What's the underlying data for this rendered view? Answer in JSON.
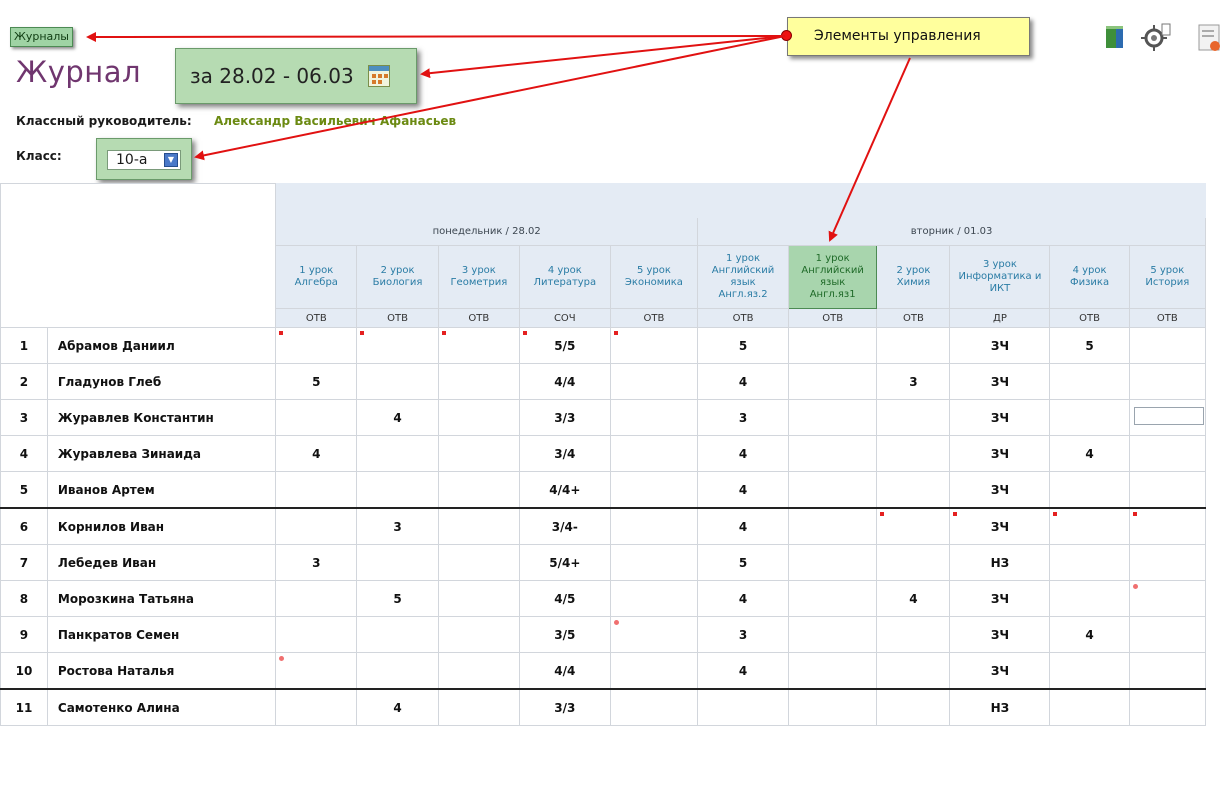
{
  "header": {
    "journals_button": "Журналы",
    "title": "Журнал",
    "date_range": "за 28.02 - 06.03",
    "teacher_label": "Классный руководитель:",
    "teacher_name": "Александр Васильевич Афанасьев",
    "class_label": "Класс:",
    "class_value": "10-а"
  },
  "annotation": {
    "callout_text": "Элементы управления"
  },
  "toolbar_icons": [
    "book-icon",
    "settings-icon",
    "document-icon"
  ],
  "days": [
    {
      "label": "понедельник / 28.02"
    },
    {
      "label": "вторник / 01.03"
    }
  ],
  "lessons": [
    {
      "num": "1 урок",
      "subject": "Алгебра",
      "sub": "",
      "type": "ОТВ"
    },
    {
      "num": "2 урок",
      "subject": "Биология",
      "sub": "",
      "type": "ОТВ"
    },
    {
      "num": "3 урок",
      "subject": "Геометрия",
      "sub": "",
      "type": "ОТВ"
    },
    {
      "num": "4 урок",
      "subject": "Литература",
      "sub": "",
      "type": "СОЧ"
    },
    {
      "num": "5 урок",
      "subject": "Экономика",
      "sub": "",
      "type": "ОТВ"
    },
    {
      "num": "1 урок",
      "subject": "Английский язык",
      "sub": "Англ.яз.2",
      "type": "ОТВ"
    },
    {
      "num": "1 урок",
      "subject": "Английский язык",
      "sub": "Англ.яз1",
      "type": "ОТВ"
    },
    {
      "num": "2 урок",
      "subject": "Химия",
      "sub": "",
      "type": "ОТВ"
    },
    {
      "num": "3 урок",
      "subject": "Информатика и ИКТ",
      "sub": "",
      "type": "ДР"
    },
    {
      "num": "4 урок",
      "subject": "Физика",
      "sub": "",
      "type": "ОТВ"
    },
    {
      "num": "5 урок",
      "subject": "История",
      "sub": "",
      "type": "ОТВ"
    }
  ],
  "students": [
    {
      "n": "1",
      "name": "Абрамов Даниил",
      "g": [
        "",
        "",
        "",
        "5/5",
        "",
        "5",
        "",
        "",
        "ЗЧ",
        "5",
        ""
      ]
    },
    {
      "n": "2",
      "name": "Гладунов Глеб",
      "g": [
        "5",
        "",
        "",
        "4/4",
        "",
        "4",
        "",
        "3",
        "ЗЧ",
        "",
        ""
      ]
    },
    {
      "n": "3",
      "name": "Журавлев Константин",
      "g": [
        "",
        "4",
        "",
        "3/3",
        "",
        "3",
        "",
        "",
        "ЗЧ",
        "",
        ""
      ]
    },
    {
      "n": "4",
      "name": "Журавлева Зинаида",
      "g": [
        "4",
        "",
        "",
        "3/4",
        "",
        "4",
        "",
        "",
        "ЗЧ",
        "4",
        ""
      ]
    },
    {
      "n": "5",
      "name": "Иванов Артем",
      "g": [
        "",
        "",
        "",
        "4/4+",
        "",
        "4",
        "",
        "",
        "ЗЧ",
        "",
        ""
      ]
    },
    {
      "n": "6",
      "name": "Корнилов Иван",
      "g": [
        "",
        "3",
        "",
        "3/4-",
        "",
        "4",
        "",
        "",
        "ЗЧ",
        "",
        ""
      ]
    },
    {
      "n": "7",
      "name": "Лебедев Иван",
      "g": [
        "3",
        "",
        "",
        "5/4+",
        "",
        "5",
        "",
        "",
        "НЗ",
        "",
        ""
      ]
    },
    {
      "n": "8",
      "name": "Морозкина Татьяна",
      "g": [
        "",
        "5",
        "",
        "4/5",
        "",
        "4",
        "",
        "4",
        "ЗЧ",
        "",
        ""
      ]
    },
    {
      "n": "9",
      "name": "Панкратов Семен",
      "g": [
        "",
        "",
        "",
        "3/5",
        "",
        "3",
        "",
        "",
        "ЗЧ",
        "4",
        ""
      ]
    },
    {
      "n": "10",
      "name": "Ростова Наталья",
      "g": [
        "",
        "",
        "",
        "4/4",
        "",
        "4",
        "",
        "",
        "ЗЧ",
        "",
        ""
      ]
    },
    {
      "n": "11",
      "name": "Самотенко Алина",
      "g": [
        "",
        "4",
        "",
        "3/3",
        "",
        "",
        "",
        "",
        "НЗ",
        "",
        ""
      ]
    }
  ],
  "colors": {
    "accent_green": "#b6dbb2",
    "title_purple": "#70366f",
    "teacher_green": "#6b8a12",
    "header_blue": "#e4ebf4",
    "lesson_blue": "#2a7ca5",
    "callout_yellow": "#ffff9d",
    "arrow_red": "#e11111"
  }
}
